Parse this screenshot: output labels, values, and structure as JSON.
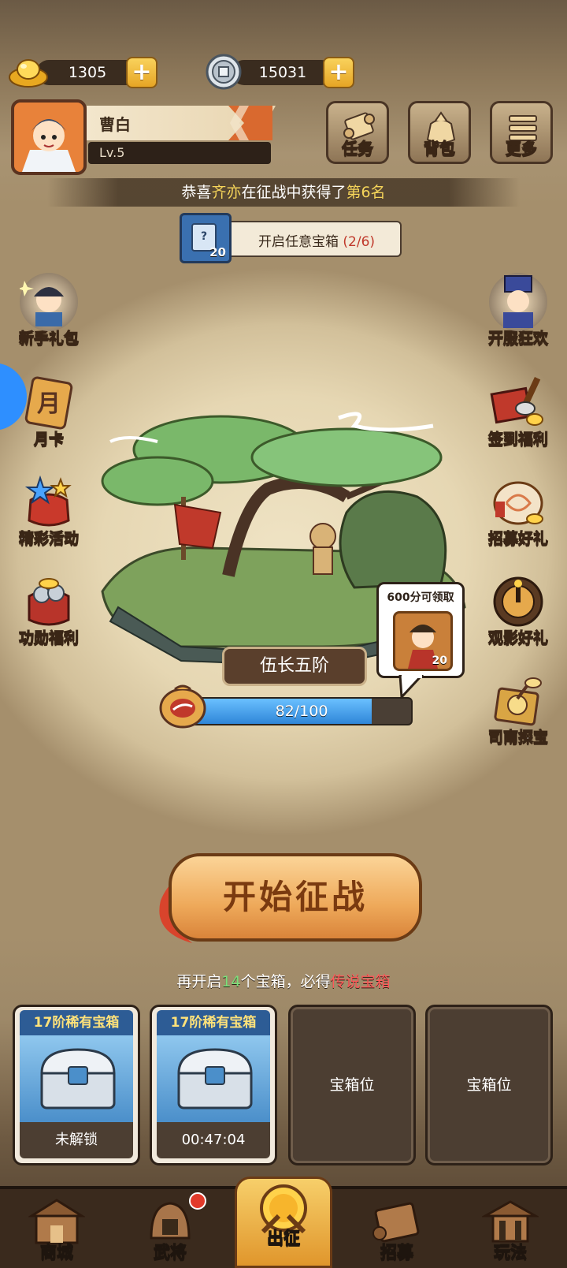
{
  "currency": {
    "gold": {
      "value": "1305",
      "icon": "gold-ingot-icon"
    },
    "silver": {
      "value": "15031",
      "icon": "silver-coin-icon"
    }
  },
  "player": {
    "name": "曹白",
    "level": "Lv.5"
  },
  "top_buttons": [
    {
      "label": "任务",
      "icon": "scroll-icon"
    },
    {
      "label": "背包",
      "icon": "bag-icon"
    },
    {
      "label": "更多",
      "icon": "menu-icon"
    }
  ],
  "announcement": {
    "prefix": "恭喜",
    "player": "齐亦",
    "middle": "在征战中获得了",
    "rank": "第6名"
  },
  "task": {
    "icon_count": "20",
    "text": "开启任意宝箱",
    "progress": "(2/6)",
    "card_glyph": "?"
  },
  "left_features": [
    {
      "label": "新手礼包"
    },
    {
      "label": "月卡",
      "glyph": "月"
    },
    {
      "label": "精彩活动"
    },
    {
      "label": "功勋福利"
    }
  ],
  "right_features": [
    {
      "label": "开服狂欢"
    },
    {
      "label": "签到福利"
    },
    {
      "label": "招募好礼"
    },
    {
      "label": "观影好礼"
    },
    {
      "label": "司南探宝"
    }
  ],
  "rank": {
    "title": "伍长五阶",
    "progress_text": "82/100",
    "progress": 0.82
  },
  "reward_bubble": {
    "title": "600分可领取",
    "count": "20"
  },
  "start_button": {
    "label": "开始征战"
  },
  "hint": {
    "prefix": "再开启",
    "count": "14",
    "middle": "个宝箱，必得",
    "reward": "传说宝箱"
  },
  "chest_slots": [
    {
      "title": "17阶稀有宝箱",
      "status": "未解锁"
    },
    {
      "title": "17阶稀有宝箱",
      "status": "00:47:04"
    },
    {
      "label": "宝箱位"
    },
    {
      "label": "宝箱位"
    }
  ],
  "nav": [
    {
      "label": "商城"
    },
    {
      "label": "武将"
    },
    {
      "label": "出征"
    },
    {
      "label": "招募"
    },
    {
      "label": "玩法"
    }
  ],
  "colors": {
    "accent_gold": "#f6d55a",
    "progress_blue": "#2f86d8",
    "alert_red": "#c0392b",
    "count_green": "#7be07b"
  }
}
